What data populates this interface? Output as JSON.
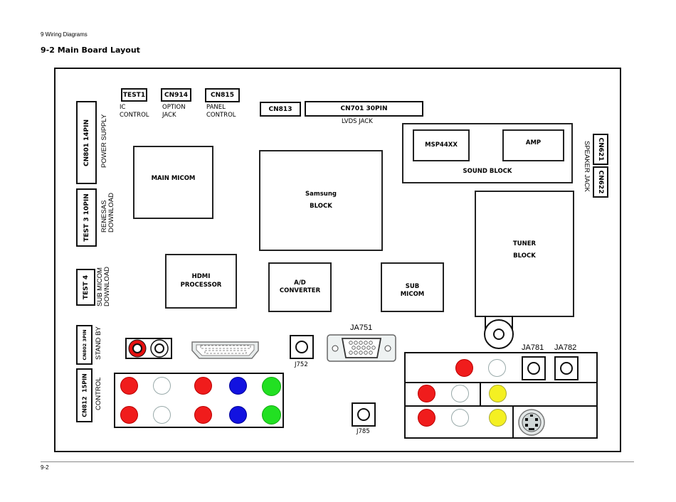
{
  "header": {
    "section": "9 Wiring Diagrams",
    "title": "9-2 Main Board Layout"
  },
  "footer": {
    "page": "9-2"
  },
  "top_connectors": [
    {
      "id": "TEST1",
      "label_lines": [
        "IC",
        "CONTROL"
      ]
    },
    {
      "id": "CN914",
      "label_lines": [
        "OPTION",
        "JACK"
      ]
    },
    {
      "id": "CN815",
      "label_lines": [
        "PANEL",
        "CONTROL"
      ]
    },
    {
      "id": "CN813"
    },
    {
      "id": "CN701 30PIN",
      "label": "LVDS JACK"
    }
  ],
  "left_connectors": [
    {
      "id": "CN801 14PIN",
      "label": "POWER SUPPLY"
    },
    {
      "id": "TEST 3 10PIN",
      "label_lines": [
        "RENESAS",
        "DOWNLOAD"
      ]
    },
    {
      "id": "TEST 4",
      "label_lines": [
        "SUB MICOM",
        "DOWNLOAD"
      ]
    },
    {
      "id": "CN802 3PIN",
      "label": "STAND BY"
    },
    {
      "id": "CN812  15PIN",
      "label": "CONTROL"
    }
  ],
  "right_connectors": [
    {
      "id": "CN621"
    },
    {
      "id": "CN622"
    }
  ],
  "speaker_label": "SPEAKER JACK",
  "blocks": {
    "main_micom": "MAIN MICOM",
    "samsung_block": [
      "Samsung",
      "BLOCK"
    ],
    "hdmi_processor": [
      "HDMI",
      "PROCESSOR"
    ],
    "ad_converter": [
      "A/D",
      "CONVERTER"
    ],
    "sub_micom": [
      "SUB",
      "MICOM"
    ],
    "msp": "MSP44XX",
    "amp": "AMP",
    "sound_block": "SOUND BLOCK",
    "tuner_block": [
      "TUNER",
      "BLOCK"
    ]
  },
  "jacks": {
    "j752": "J752",
    "j785": "J785",
    "ja751": "JA751",
    "ja781": "JA781",
    "ja782": "JA782"
  },
  "colors": {
    "red": "#f01c1c",
    "white": "#ffffff",
    "blue": "#1212e0",
    "green": "#22e022",
    "yellow": "#f4f022"
  }
}
